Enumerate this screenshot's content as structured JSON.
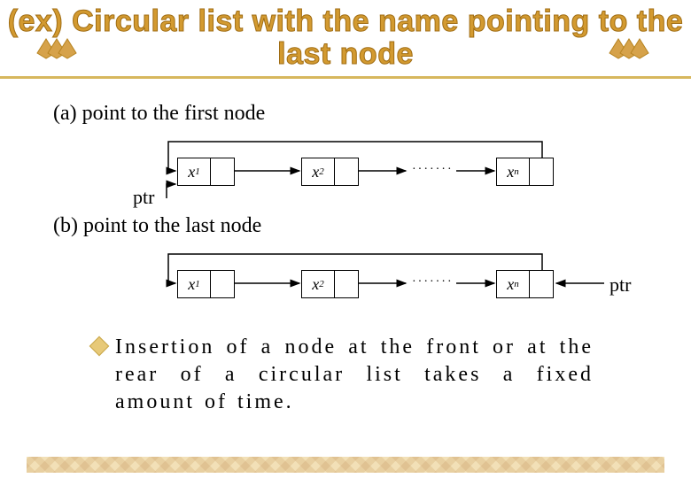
{
  "title": "(ex) Circular list with the name pointing to the last node",
  "section_a": {
    "label": "(a) point to the first node",
    "nodes": [
      "x1",
      "x2",
      "xn"
    ],
    "ellipsis": "·······",
    "ptr_label": "ptr"
  },
  "section_b": {
    "label": "(b) point to the last node",
    "nodes": [
      "x1",
      "x2",
      "xn"
    ],
    "ellipsis": "·······",
    "ptr_label": "ptr"
  },
  "note": "Insertion of a node at the front or at the rear of a circular list takes a fixed amount of time.",
  "colors": {
    "accent": "#d39a30",
    "rule": "#d7b75d"
  }
}
